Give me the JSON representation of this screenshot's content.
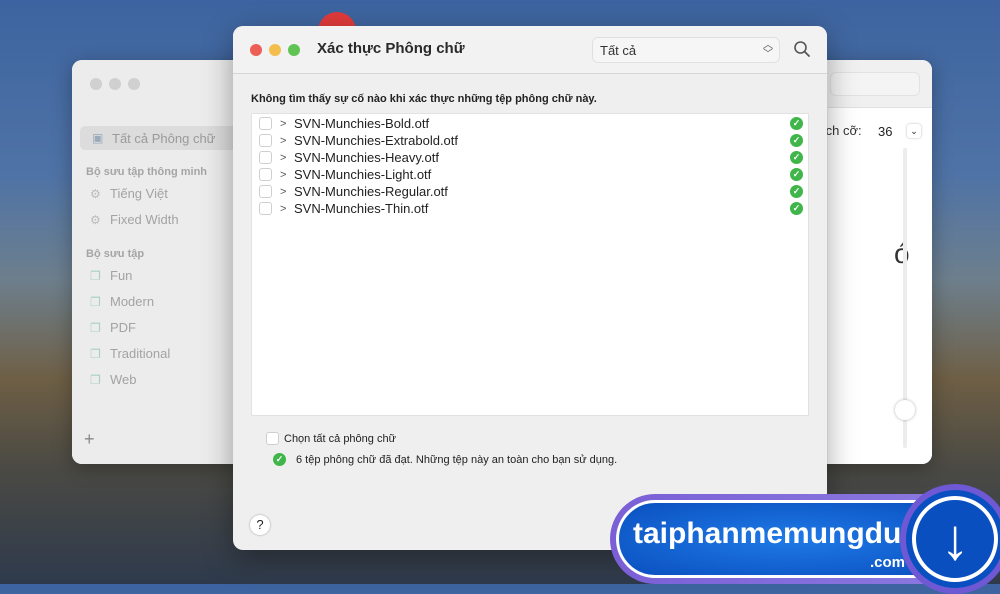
{
  "back_window": {
    "sidebar": {
      "selected": "Tất cả Phông chữ",
      "smart_heading": "Bộ sưu tập thông minh",
      "smart_items": [
        "Tiếng Việt",
        "Fixed Width"
      ],
      "collections_heading": "Bộ sưu tập",
      "collections": [
        "Fun",
        "Modern",
        "PDF",
        "Traditional",
        "Web"
      ],
      "add_label": "+"
    },
    "size_label": "ích cỡ:",
    "size_value": "36",
    "preview_glyph": "ó"
  },
  "dialog": {
    "title": "Xác thực Phông chữ",
    "filter_value": "Tất cả",
    "message": "Không tìm thấy sự cố nào khi xác thực những tệp phông chữ này.",
    "files": [
      "SVN-Munchies-Bold.otf",
      "SVN-Munchies-Extrabold.otf",
      "SVN-Munchies-Heavy.otf",
      "SVN-Munchies-Light.otf",
      "SVN-Munchies-Regular.otf",
      "SVN-Munchies-Thin.otf"
    ],
    "select_all_label": "Chọn tất cả phông chữ",
    "status_text": "6 tệp phông chữ đã đạt. Những tệp này an toàn cho bạn sử dụng.",
    "help_label": "?"
  },
  "watermark": {
    "name": "taiphanmemungdung",
    "suffix": ".com"
  },
  "colors": {
    "ok": "#3fb54a",
    "close": "#ec5f57",
    "minimize": "#f4be4f",
    "zoom": "#5fc454"
  }
}
